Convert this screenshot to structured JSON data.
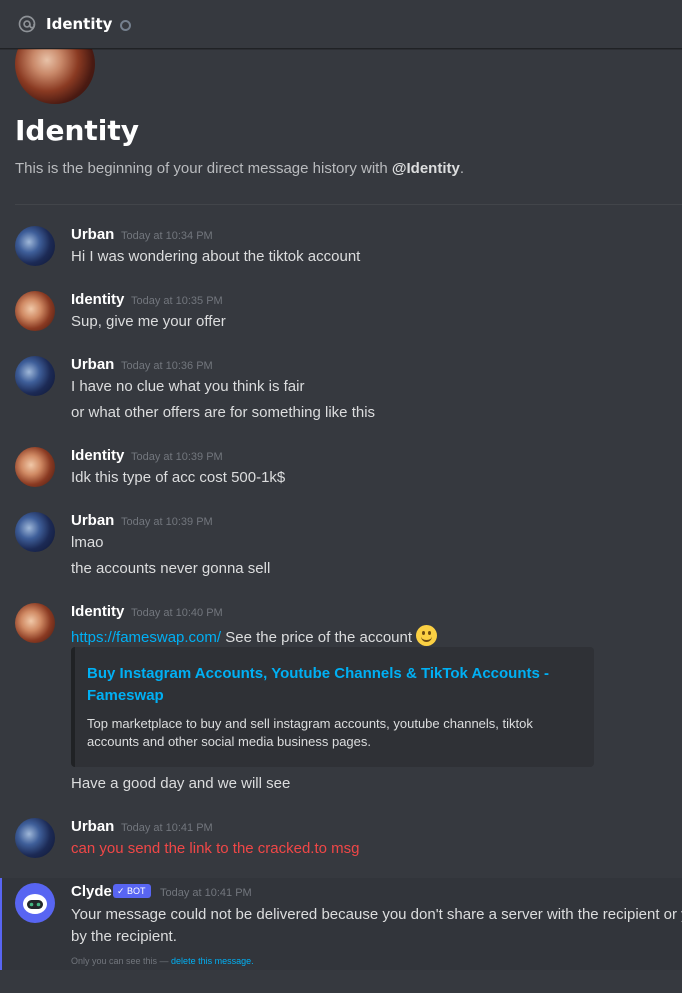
{
  "header": {
    "title": "Identity",
    "at_icon": "at-icon",
    "status_icon": "offline-status-icon"
  },
  "intro": {
    "title": "Identity",
    "subtitle_prefix": "This is the beginning of your direct message history with ",
    "subtitle_user": "@Identity",
    "subtitle_suffix": "."
  },
  "messages": [
    {
      "author": "Urban",
      "time": "Today at 10:34 PM",
      "lines": [
        "Hi I was wondering about the tiktok account"
      ]
    },
    {
      "author": "Identity",
      "time": "Today at 10:35 PM",
      "lines": [
        "Sup, give me your offer"
      ]
    },
    {
      "author": "Urban",
      "time": "Today at 10:36 PM",
      "lines": [
        "I have no clue what you think is fair",
        "or what other offers are for something like this"
      ]
    },
    {
      "author": "Identity",
      "time": "Today at 10:39 PM",
      "lines": [
        "Idk this type of acc cost 500-1k$"
      ]
    },
    {
      "author": "Urban",
      "time": "Today at 10:39 PM",
      "lines": [
        "lmao",
        "the accounts never gonna sell"
      ]
    },
    {
      "author": "Identity",
      "time": "Today at 10:40 PM",
      "link": "https://fameswap.com/",
      "link_suffix": " See the price of the account",
      "emoji": "slightly-smiling-face-icon",
      "embed": {
        "title": "Buy Instagram Accounts, Youtube Channels & TikTok Accounts - Fameswap",
        "description": "Top marketplace to buy and sell instagram accounts, youtube channels, tiktok accounts and other social media business pages."
      },
      "after": "Have a good day and we will see"
    },
    {
      "author": "Urban",
      "time": "Today at 10:41 PM",
      "lines": [
        "can you send the link to the cracked.to msg"
      ],
      "failed": true
    },
    {
      "author": "Clyde",
      "badge": "✓ BOT",
      "time": "Today at 10:41 PM",
      "lines": [
        "Your message could not be delivered because you don't share a server with the recipient or y",
        "by the recipient."
      ],
      "notice_prefix": "Only you can see this — ",
      "notice_link": "delete this message."
    }
  ],
  "colors": {
    "background": "#36393f",
    "link": "#00b0f4",
    "error": "#f04747",
    "blurple": "#5865f2"
  }
}
